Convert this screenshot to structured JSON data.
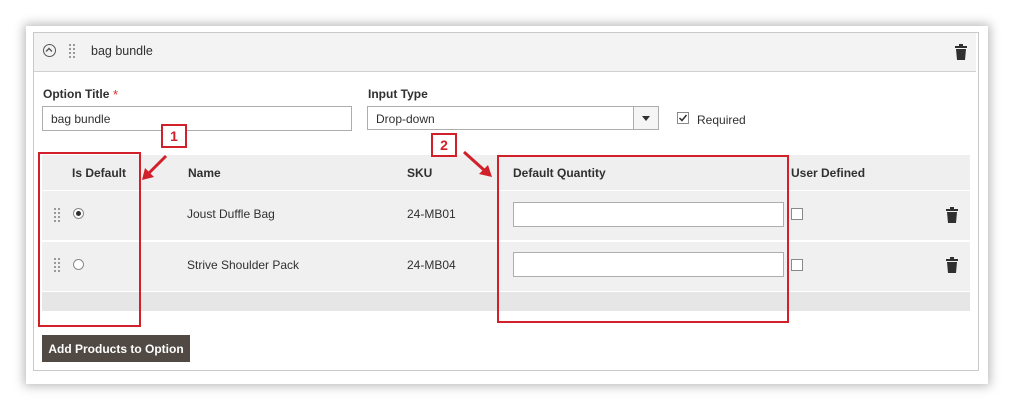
{
  "option": {
    "title": "bag bundle"
  },
  "form": {
    "option_title_label": "Option Title",
    "option_title_required_mark": "*",
    "option_title_value": "bag bundle",
    "input_type_label": "Input Type",
    "input_type_value": "Drop-down",
    "required_label": "Required",
    "required_checked": true
  },
  "table": {
    "headers": {
      "is_default": "Is Default",
      "name": "Name",
      "sku": "SKU",
      "default_quantity": "Default Quantity",
      "user_defined": "User Defined"
    },
    "rows": [
      {
        "name": "Joust Duffle Bag",
        "sku": "24-MB01",
        "is_default": true,
        "default_quantity": "",
        "user_defined": false
      },
      {
        "name": "Strive Shoulder Pack",
        "sku": "24-MB04",
        "is_default": false,
        "default_quantity": "",
        "user_defined": false
      }
    ]
  },
  "add_products_button": "Add Products to Option",
  "annotations": {
    "badge_1": "1",
    "badge_2": "2",
    "highlight_color": "#d2202a"
  },
  "icons": [
    "collapse-toggle-icon",
    "drag-handle-icon",
    "trash-icon",
    "checkmark-icon",
    "dropdown-arrow-icon"
  ]
}
